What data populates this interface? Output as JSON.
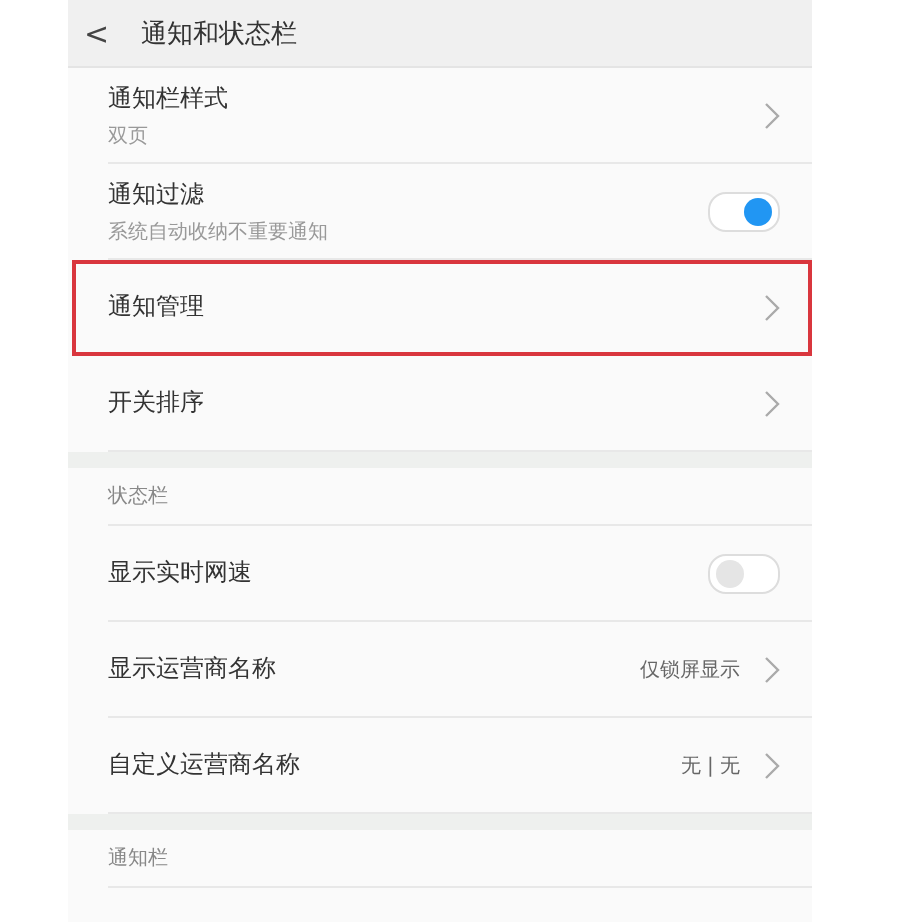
{
  "header": {
    "back_icon": "<",
    "title": "通知和状态栏"
  },
  "groups": [
    {
      "items": [
        {
          "kind": "link",
          "label": "通知栏样式",
          "subtitle": "双页",
          "highlighted": false
        },
        {
          "kind": "switch",
          "label": "通知过滤",
          "subtitle": "系统自动收纳不重要通知",
          "on": true,
          "highlighted": false
        },
        {
          "kind": "link",
          "label": "通知管理",
          "highlighted": true
        },
        {
          "kind": "link",
          "label": "开关排序",
          "highlighted": false
        }
      ]
    },
    {
      "title": "状态栏",
      "items": [
        {
          "kind": "switch",
          "label": "显示实时网速",
          "on": false,
          "highlighted": false
        },
        {
          "kind": "link",
          "label": "显示运营商名称",
          "value": "仅锁屏显示",
          "highlighted": false
        },
        {
          "kind": "link",
          "label": "自定义运营商名称",
          "value": "无 | 无",
          "highlighted": false
        }
      ]
    },
    {
      "title": "通知栏"
    }
  ]
}
